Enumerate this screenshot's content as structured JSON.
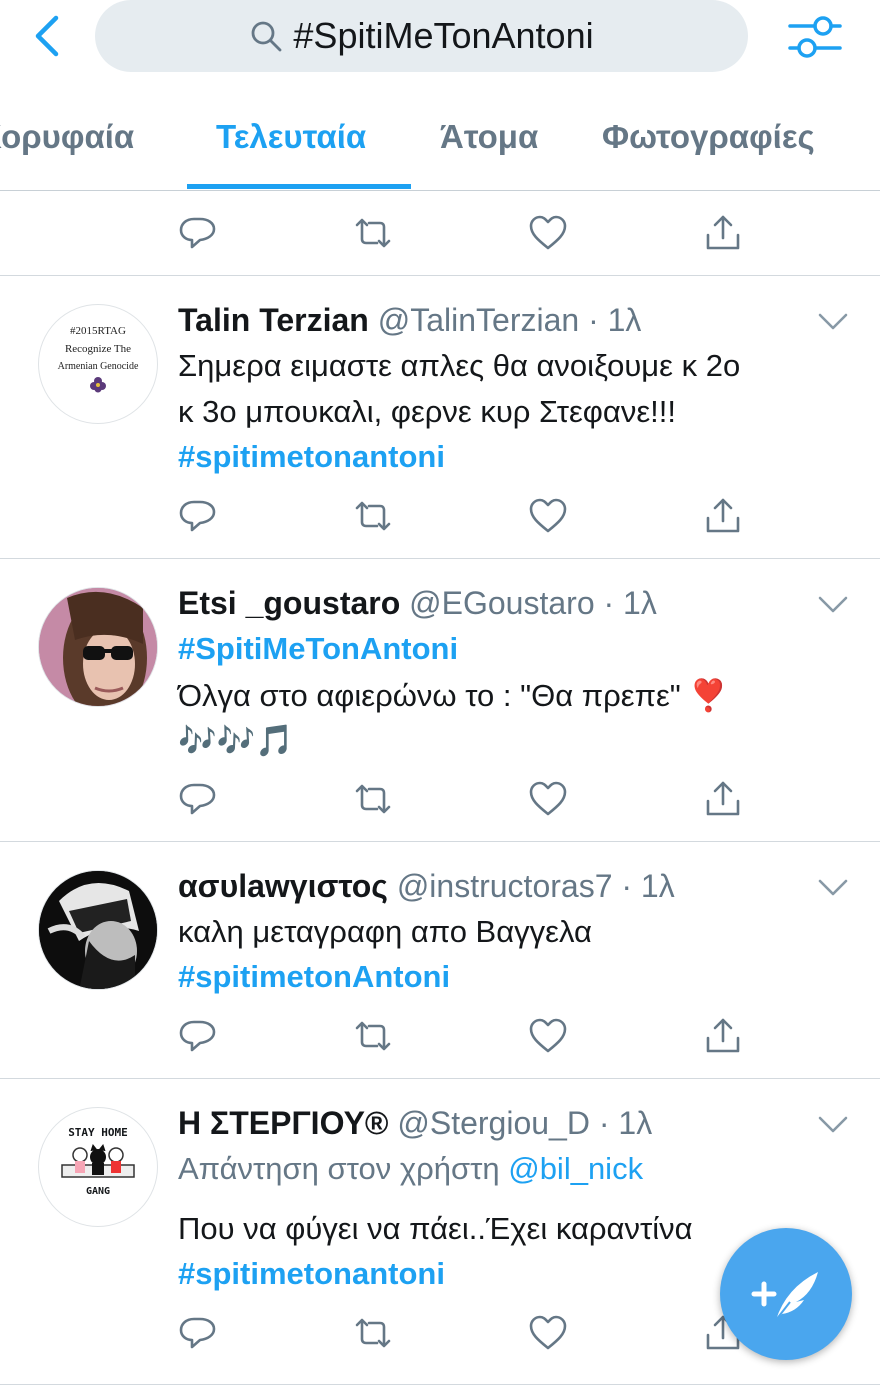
{
  "search": {
    "query": "#SpitiMeTonAntoni"
  },
  "tabs": [
    "Κορυφαία",
    "Τελευταία",
    "Άτομα",
    "Φωτογραφίες"
  ],
  "tweets": [
    {
      "name": "Talin Terzian",
      "handle": "@TalinTerzian · 1λ",
      "avatar_text": [
        "#2015RTAG",
        "Recognize The",
        "Armenian Genocide"
      ],
      "lines": [
        "Σημερα ειμαστε απλες θα ανοιξουμε κ 2ο",
        "κ 3ο μπουκαλι, φερνε κυρ Στεφανε!!!"
      ],
      "hashtag": "#spitimetonantoni"
    },
    {
      "name": "Etsi _goustaro",
      "handle": "@EGoustaro · 1λ",
      "hashtag": "#SpitiMeTonAntoni",
      "lines": [
        "Όλγα στο αφιερώνω το : \"Θα πρεπε\" ❣️",
        "🎶🎶🎵"
      ]
    },
    {
      "name": "ασυlawγιστος",
      "handle": "@instructoras7 · 1λ",
      "lines": [
        "καλη μεταγραφη απο Βαγγελα"
      ],
      "hashtag": "#spitimetonAntoni"
    },
    {
      "name": "Η ΣΤΕΡΓΙΟΥ®",
      "handle": "@Stergiou_D · 1λ",
      "reply_prefix": "Απάντηση στον χρήστη",
      "reply_to": "@bil_nick",
      "lines": [
        "Που να φύγει να πάει..Έχει καραντίνα"
      ],
      "hashtag": "#spitimetonantoni",
      "avatar_text": [
        "STAY HOME",
        "GANG"
      ]
    }
  ],
  "icons": [
    "back-icon",
    "search-icon",
    "filter-icon",
    "reply-icon",
    "retweet-icon",
    "like-icon",
    "share-icon",
    "chevron-down-icon",
    "compose-icon"
  ],
  "colors": {
    "accent": "#1da1f2",
    "muted": "#657786",
    "fab": "#4aa6ee"
  }
}
